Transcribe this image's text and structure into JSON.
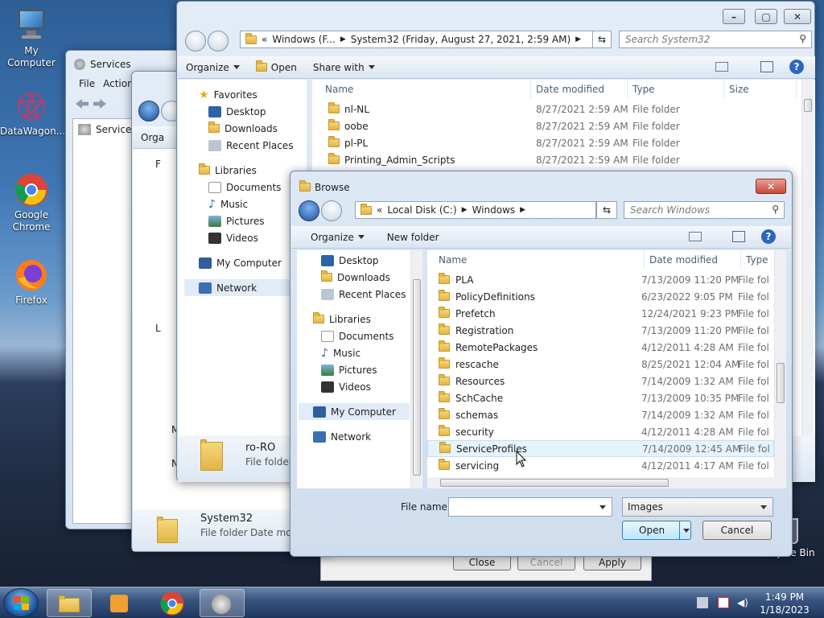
{
  "desktop": {
    "icons": [
      {
        "label": "My Computer"
      },
      {
        "label": "DataWagon..."
      },
      {
        "label": "Google Chrome"
      },
      {
        "label": "Firefox"
      },
      {
        "label": "Recycle Bin"
      }
    ]
  },
  "services_window": {
    "title": "Services",
    "menu": [
      "File",
      "Action"
    ],
    "tree_item": "Services",
    "buttons": {
      "close": "Close",
      "cancel": "Cancel",
      "apply": "Apply"
    }
  },
  "explorer2": {
    "toolbar_partial": "Orga",
    "nav_partial": [
      "F",
      "L",
      "M",
      "N"
    ],
    "details": {
      "name": "System32",
      "type": "File folder",
      "extra": "Date mod"
    }
  },
  "explorer_main": {
    "address": {
      "prefix": "«",
      "part1": "Windows (F...",
      "part2": "System32 (Friday, August 27, 2021, 2:59 AM)"
    },
    "search_placeholder": "Search System32",
    "toolbar": {
      "organize": "Organize",
      "open": "Open",
      "share": "Share with"
    },
    "nav": {
      "favorites": "Favorites",
      "desktop": "Desktop",
      "downloads": "Downloads",
      "recent": "Recent Places",
      "libraries": "Libraries",
      "documents": "Documents",
      "music": "Music",
      "pictures": "Pictures",
      "videos": "Videos",
      "computer": "My Computer",
      "network": "Network"
    },
    "columns": {
      "name": "Name",
      "date": "Date modified",
      "type": "Type",
      "size": "Size"
    },
    "rows": [
      {
        "name": "nl-NL",
        "date": "8/27/2021 2:59 AM",
        "type": "File folder"
      },
      {
        "name": "oobe",
        "date": "8/27/2021 2:59 AM",
        "type": "File folder"
      },
      {
        "name": "pl-PL",
        "date": "8/27/2021 2:59 AM",
        "type": "File folder"
      },
      {
        "name": "Printing_Admin_Scripts",
        "date": "8/27/2021 2:59 AM",
        "type": "File folder"
      }
    ],
    "details": {
      "name": "ro-RO",
      "type": "File folder"
    }
  },
  "browse_dialog": {
    "title": "Browse",
    "address": {
      "prefix": "«",
      "part1": "Local Disk (C:)",
      "part2": "Windows"
    },
    "search_placeholder": "Search Windows",
    "toolbar": {
      "organize": "Organize",
      "new_folder": "New folder"
    },
    "nav": {
      "desktop": "Desktop",
      "downloads": "Downloads",
      "recent": "Recent Places",
      "libraries": "Libraries",
      "documents": "Documents",
      "music": "Music",
      "pictures": "Pictures",
      "videos": "Videos",
      "computer": "My Computer",
      "network": "Network"
    },
    "columns": {
      "name": "Name",
      "date": "Date modified",
      "type": "Type"
    },
    "rows": [
      {
        "name": "PLA",
        "date": "7/13/2009 11:20 PM",
        "type": "File fol"
      },
      {
        "name": "PolicyDefinitions",
        "date": "6/23/2022 9:05 PM",
        "type": "File fol"
      },
      {
        "name": "Prefetch",
        "date": "12/24/2021 9:23 PM",
        "type": "File fol"
      },
      {
        "name": "Registration",
        "date": "7/13/2009 11:20 PM",
        "type": "File fol"
      },
      {
        "name": "RemotePackages",
        "date": "4/12/2011 4:28 AM",
        "type": "File fol"
      },
      {
        "name": "rescache",
        "date": "8/25/2021 12:04 AM",
        "type": "File fol"
      },
      {
        "name": "Resources",
        "date": "7/14/2009 1:32 AM",
        "type": "File fol"
      },
      {
        "name": "SchCache",
        "date": "7/13/2009 10:35 PM",
        "type": "File fol"
      },
      {
        "name": "schemas",
        "date": "7/14/2009 1:32 AM",
        "type": "File fol"
      },
      {
        "name": "security",
        "date": "4/12/2011 4:28 AM",
        "type": "File fol"
      },
      {
        "name": "ServiceProfiles",
        "date": "7/14/2009 12:45 AM",
        "type": "File fol"
      },
      {
        "name": "servicing",
        "date": "4/12/2011 4:17 AM",
        "type": "File fol"
      }
    ],
    "hovered_row_index": 10,
    "file_name_label": "File name:",
    "file_name_value": "",
    "filter": "Images",
    "open_button": "Open",
    "cancel_button": "Cancel"
  },
  "taskbar": {
    "time": "1:49 PM",
    "date": "1/18/2023"
  },
  "colors": {
    "accent": "#3b6fc2",
    "hover_row": "#e5f3fb",
    "close_red": "#c9483b"
  }
}
